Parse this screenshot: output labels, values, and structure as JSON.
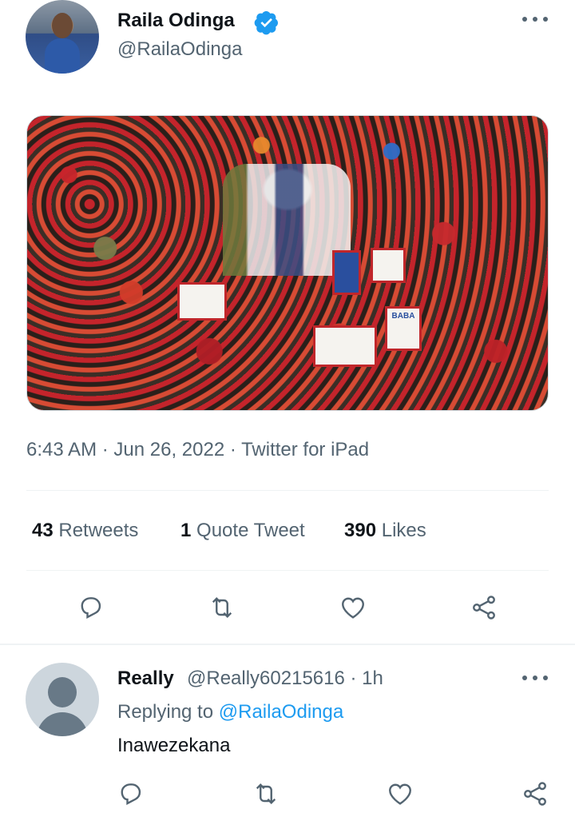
{
  "tweet": {
    "author": {
      "name": "Raila Odinga",
      "handle": "@RailaOdinga",
      "verified": true
    },
    "media": {
      "alt_kind": "photo-crowd-rally",
      "poster_text": "BABA"
    },
    "timestamp": "6:43 AM · Jun 26, 2022 · Twitter for iPad",
    "stats": {
      "retweets_count": "43",
      "retweets_label": "Retweets",
      "quotes_count": "1",
      "quotes_label": "Quote Tweet",
      "likes_count": "390",
      "likes_label": "Likes"
    },
    "actions": [
      "reply-icon",
      "retweet-icon",
      "like-icon",
      "share-icon"
    ]
  },
  "reply": {
    "author_name": "Really",
    "meta": "@Really60215616 · 1h",
    "replying_prefix": "Replying to ",
    "replying_to": "@RailaOdinga",
    "text": "Inawezekana",
    "actions": [
      "reply-icon",
      "retweet-icon",
      "like-icon",
      "share-icon"
    ]
  },
  "colors": {
    "text_primary": "#0f1419",
    "text_secondary": "#536471",
    "accent": "#1d9bf0",
    "divider": "#eff3f4"
  }
}
